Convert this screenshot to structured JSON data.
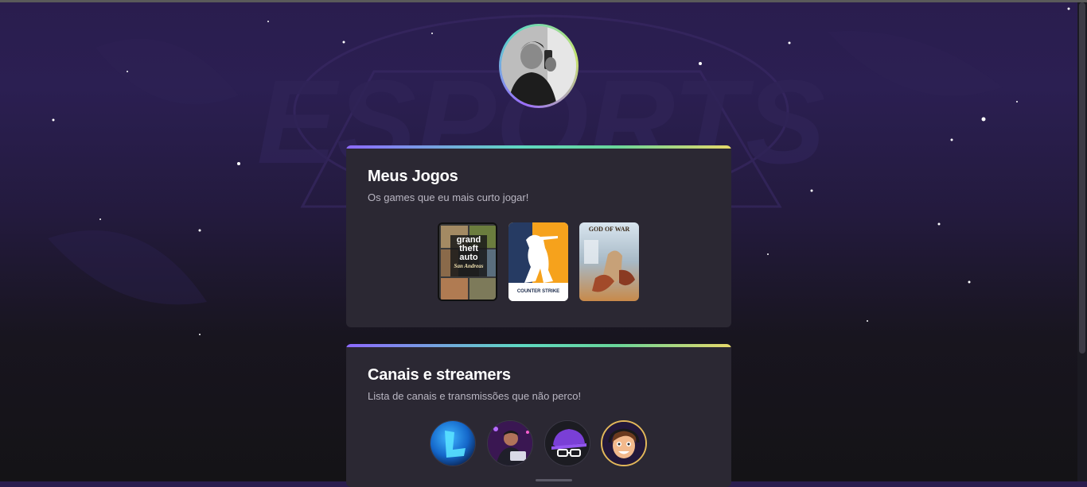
{
  "profile": {
    "avatar_alt": "profile-photo"
  },
  "background": {
    "logo_text": "ESPORTS"
  },
  "games_section": {
    "title": "Meus Jogos",
    "subtitle": "Os games que eu mais curto jogar!",
    "games": [
      {
        "name": "Grand Theft Auto San Andreas",
        "cover_lines": [
          "grand",
          "theft",
          "auto",
          "San Andreas"
        ]
      },
      {
        "name": "Counter Strike",
        "cover_label": "COUNTER STRIKE"
      },
      {
        "name": "God of War",
        "cover_label": "GOD OF WAR"
      }
    ]
  },
  "channels_section": {
    "title": "Canais e streamers",
    "subtitle": "Lista de canais e transmissões que não perco!",
    "channels": [
      {
        "name": "channel-1"
      },
      {
        "name": "channel-2"
      },
      {
        "name": "channel-3"
      },
      {
        "name": "channel-4"
      }
    ]
  },
  "colors": {
    "accent_purple": "#8d69ff",
    "accent_teal": "#5fd8c2",
    "accent_yellow": "#e7d86a",
    "card_bg": "#2b2833"
  }
}
